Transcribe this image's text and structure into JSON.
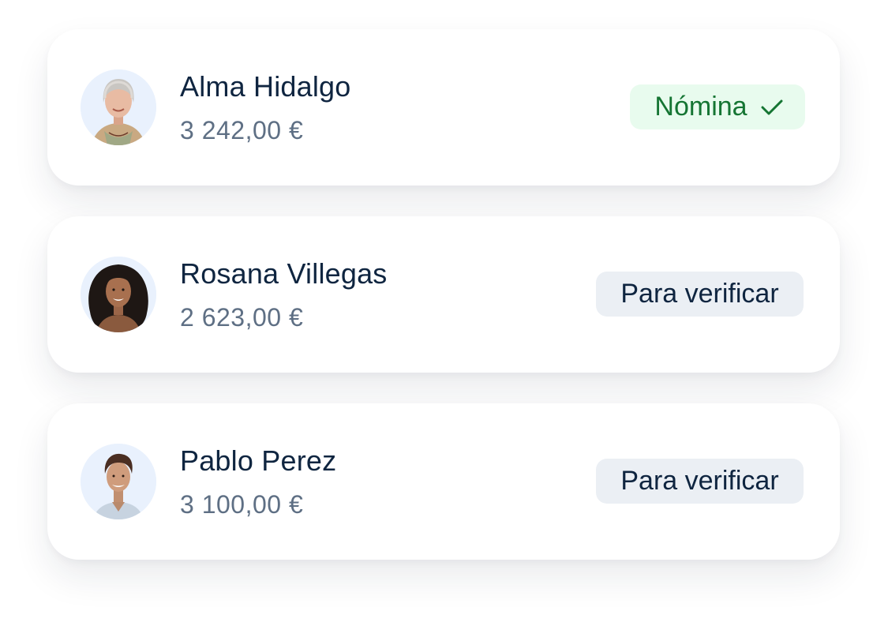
{
  "people": [
    {
      "name": "Alma Hidalgo",
      "amount": "3 242,00 €",
      "status": "Nómina",
      "status_type": "verified",
      "status_icon": "check-icon"
    },
    {
      "name": "Rosana Villegas",
      "amount": "2 623,00 €",
      "status": "Para verificar",
      "status_type": "pending"
    },
    {
      "name": "Pablo Perez",
      "amount": "3 100,00 €",
      "status": "Para verificar",
      "status_type": "pending"
    }
  ],
  "colors": {
    "verified_bg": "#e8fbee",
    "verified_text": "#157533",
    "pending_bg": "#ebeff4",
    "name_text": "#0f2540",
    "amount_text": "#5e6f84"
  }
}
